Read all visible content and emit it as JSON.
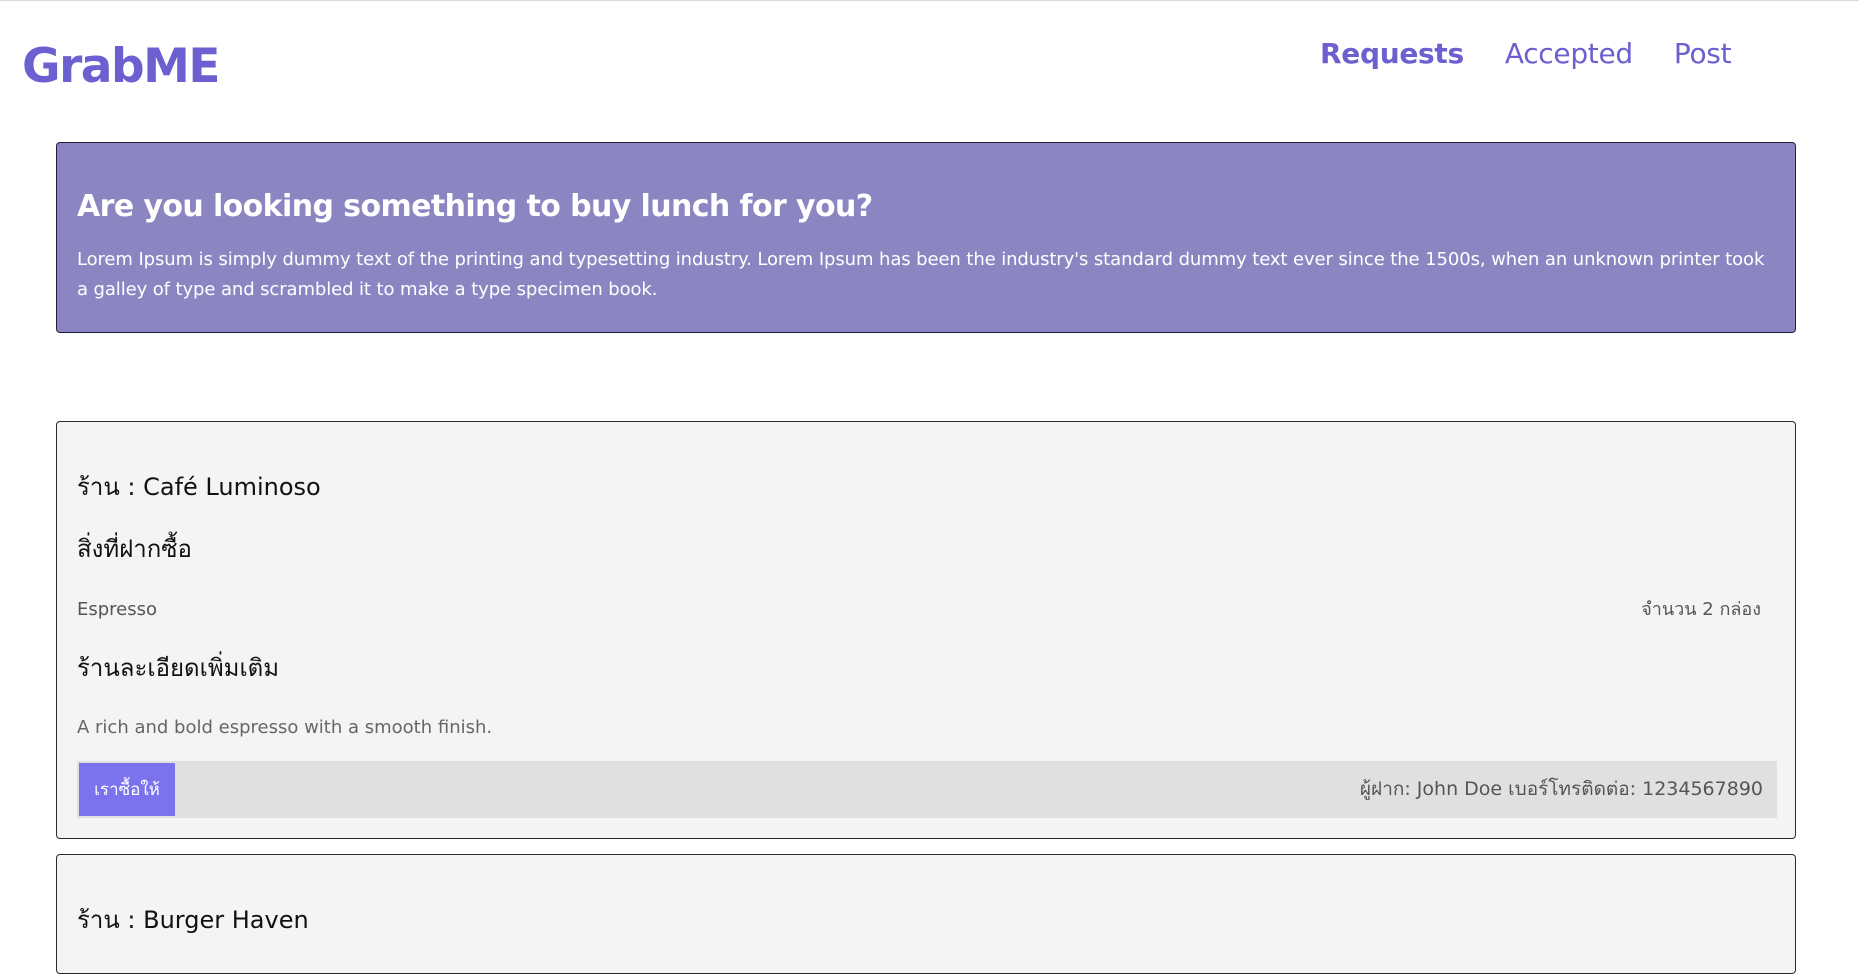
{
  "brand": {
    "logo": "GrabME",
    "color": "#6c5fcf"
  },
  "nav": {
    "items": [
      {
        "label": "Requests",
        "active": true
      },
      {
        "label": "Accepted",
        "active": false
      },
      {
        "label": "Post",
        "active": false
      }
    ]
  },
  "hero": {
    "title": "Are you looking something to buy lunch for you?",
    "body": "Lorem Ipsum is simply dummy text of the printing and typesetting industry. Lorem Ipsum has been the industry's standard dummy text ever since the 1500s, when an unknown printer took a galley of type and scrambled it to make a type specimen book.",
    "background": "#8b86c2"
  },
  "requests": [
    {
      "shop": "ร้าน : Café Luminoso",
      "wish_heading": "สิ่งที่ฝากซื้อ",
      "item_name": "Espresso",
      "item_qty": "จำนวน 2 กล่อง",
      "detail_heading": "ร้านละเอียดเพิ่มเติม",
      "detail_text": "A rich and bold espresso with a smooth finish.",
      "button_label": "เราซื้อให้",
      "owner": "ผู้ฝาก: John Doe เบอร์โทรติดต่อ: 1234567890"
    },
    {
      "shop": "ร้าน : Burger Haven"
    }
  ],
  "colors": {
    "button": "#7b73ee",
    "card_bg": "#f4f4f4",
    "footer_bg": "#e0e0e0"
  }
}
